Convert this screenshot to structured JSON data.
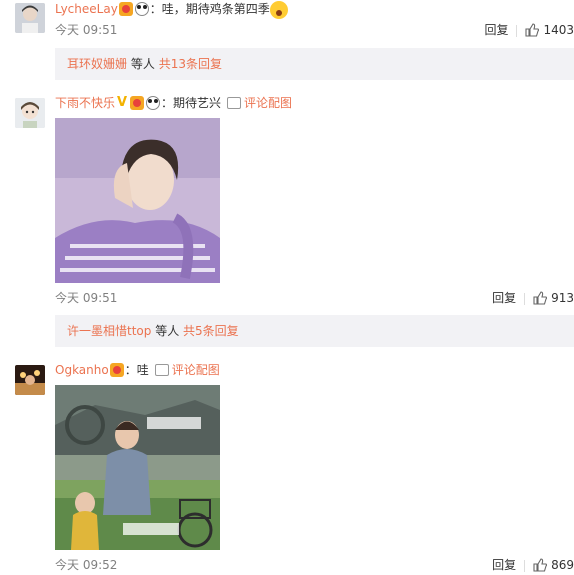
{
  "comments": [
    {
      "username": "LycheeLay",
      "text": "：哇，期待鸡条第四季",
      "time": "今天 09:51",
      "reply_label": "回复",
      "like_count": "1403",
      "more": {
        "users": "耳环奴姗姗",
        "mid": "等人",
        "count": "共13条回复"
      }
    },
    {
      "username": "下雨不快乐",
      "text": "：期待艺兴",
      "pic_label": "评论配图",
      "time": "今天 09:51",
      "reply_label": "回复",
      "like_count": "913",
      "more": {
        "users": "许一墨相惜ttop",
        "mid": "等人",
        "count": "共5条回复"
      }
    },
    {
      "username": "Ogkanho",
      "text": "：哇",
      "pic_label": "评论配图",
      "time": "今天 09:52",
      "reply_label": "回复",
      "like_count": "869"
    }
  ],
  "colors": {
    "link": "#eb7350",
    "time": "#808080",
    "more_bg": "#f2f2f5"
  }
}
